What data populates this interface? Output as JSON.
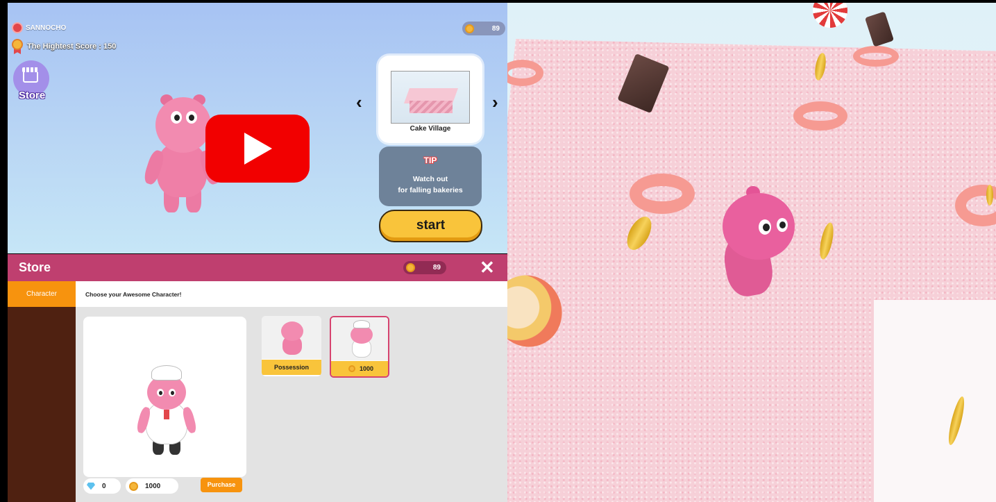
{
  "menu": {
    "player_name": "SANNOCHO",
    "highest_score": "The Hightest Score : 150",
    "coins": "89",
    "store_label": "Store",
    "map_name": "Cake Village",
    "tip_title": "TIP",
    "tip_line1": "Watch out",
    "tip_line2": "for falling bakeries",
    "start_label": "start",
    "arrow_left": "‹",
    "arrow_right": "›"
  },
  "store": {
    "title": "Store",
    "coins": "89",
    "close": "✕",
    "tab_character": "Character",
    "subtitle": "Choose your Awesome Character!",
    "gems": "0",
    "coin_balance": "1000",
    "purchase_label": "Purchase",
    "cards": [
      {
        "label": "Possession"
      },
      {
        "label": "1000"
      }
    ]
  },
  "colors": {
    "store_header": "#bf3f6f",
    "store_sidebar": "#4f2111",
    "accent_orange": "#f7930e",
    "start_yellow": "#f9c43b",
    "youtube_red": "#f20000",
    "hippo_pink": "#f28bb0"
  },
  "icons": [
    "player-avatar-icon",
    "medal-icon",
    "coin-icon",
    "store-icon",
    "youtube-play-icon",
    "close-icon",
    "gem-icon",
    "chef-hat-icon"
  ]
}
